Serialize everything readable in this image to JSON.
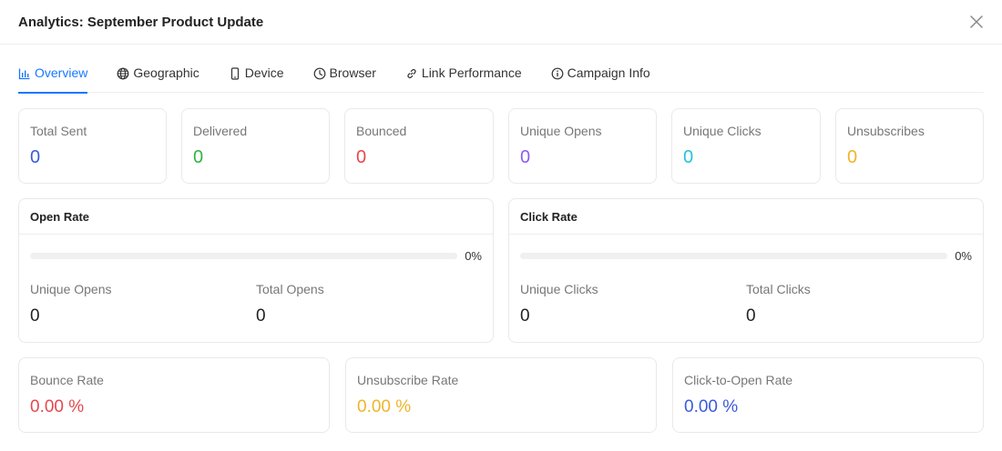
{
  "modal": {
    "title": "Analytics: September Product Update"
  },
  "tabs": [
    {
      "label": "Overview",
      "icon": "bar-chart-icon",
      "active": true
    },
    {
      "label": "Geographic",
      "icon": "globe-icon"
    },
    {
      "label": "Device",
      "icon": "mobile-icon"
    },
    {
      "label": "Browser",
      "icon": "clock-icon"
    },
    {
      "label": "Link Performance",
      "icon": "link-icon"
    },
    {
      "label": "Campaign Info",
      "icon": "info-icon"
    }
  ],
  "stats": [
    {
      "label": "Total Sent",
      "value": "0",
      "color": "#3b5bdb"
    },
    {
      "label": "Delivered",
      "value": "0",
      "color": "#2fb344"
    },
    {
      "label": "Bounced",
      "value": "0",
      "color": "#e5484d"
    },
    {
      "label": "Unique Opens",
      "value": "0",
      "color": "#8b5cf6"
    },
    {
      "label": "Unique Clicks",
      "value": "0",
      "color": "#22c3dd"
    },
    {
      "label": "Unsubscribes",
      "value": "0",
      "color": "#f0b429"
    }
  ],
  "open_rate": {
    "title": "Open Rate",
    "percent_label": "0%",
    "percent": 0,
    "unique_label": "Unique Opens",
    "unique_value": "0",
    "total_label": "Total Opens",
    "total_value": "0"
  },
  "click_rate": {
    "title": "Click Rate",
    "percent_label": "0%",
    "percent": 0,
    "unique_label": "Unique Clicks",
    "unique_value": "0",
    "total_label": "Total Clicks",
    "total_value": "0"
  },
  "rates": [
    {
      "label": "Bounce Rate",
      "value": "0.00 %",
      "color": "#e5484d"
    },
    {
      "label": "Unsubscribe Rate",
      "value": "0.00 %",
      "color": "#f0b429"
    },
    {
      "label": "Click-to-Open Rate",
      "value": "0.00 %",
      "color": "#3b5bdb"
    }
  ],
  "colors": {
    "accent": "#1677ff"
  }
}
